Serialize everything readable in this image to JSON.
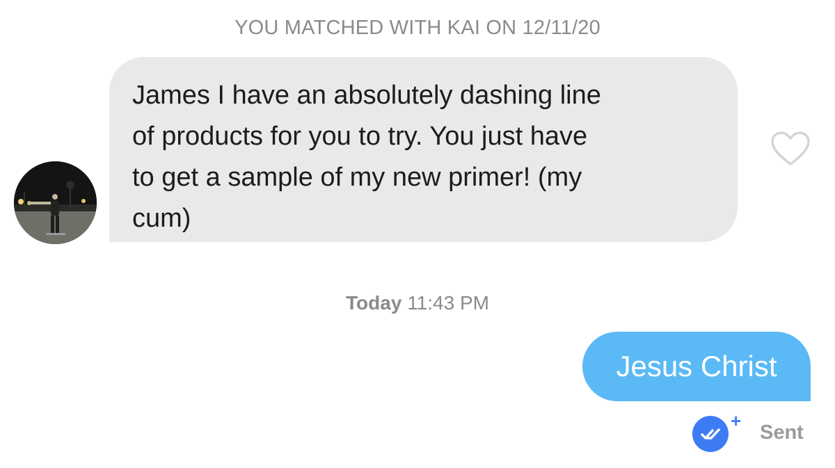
{
  "match_header": {
    "text": "YOU MATCHED WITH KAI ON 12/11/20"
  },
  "incoming_message": {
    "lines": [
      "James I have an absolutely dashing line",
      "of products for you to try. You just have",
      "to get a sample of my new primer! (my",
      "cum)"
    ],
    "bubble_color": "#e9e9eb",
    "like_icon": "heart-outline-icon"
  },
  "timestamp": {
    "day": "Today",
    "time": "11:43 PM"
  },
  "outgoing_message": {
    "text": "Jesus Christ",
    "bubble_color": "#5bb9f5"
  },
  "status": {
    "icon": "double-check-icon",
    "plus": "+",
    "label": "Sent",
    "accent_color": "#3e7cf5"
  }
}
